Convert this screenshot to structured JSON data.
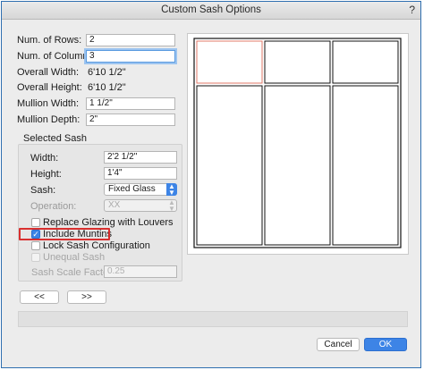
{
  "window": {
    "title": "Custom Sash Options",
    "help_glyph": "?"
  },
  "form": {
    "rows_label": "Num. of Rows:",
    "rows_value": "2",
    "columns_label": "Num. of Columns:",
    "columns_value": "3",
    "overall_width_label": "Overall Width:",
    "overall_width_value": "6'10 1/2\"",
    "overall_height_label": "Overall Height:",
    "overall_height_value": "6'10 1/2\"",
    "mullion_width_label": "Mullion Width:",
    "mullion_width_value": "1 1/2\"",
    "mullion_depth_label": "Mullion Depth:",
    "mullion_depth_value": "2\""
  },
  "selected_sash": {
    "group_label": "Selected Sash",
    "width_label": "Width:",
    "width_value": "2'2 1/2\"",
    "height_label": "Height:",
    "height_value": "1'4\"",
    "sash_label": "Sash:",
    "sash_value": "Fixed Glass",
    "operation_label": "Operation:",
    "operation_value": "XX",
    "replace_glazing_label": "Replace Glazing with Louvers",
    "include_muntins_label": "Include Muntins",
    "lock_sash_label": "Lock Sash Configuration",
    "unequal_sash_label": "Unequal Sash",
    "scale_factor_label": "Sash Scale Factor:",
    "scale_factor_value": "0.25"
  },
  "checkboxes": {
    "replace_glazing": false,
    "include_muntins": true,
    "lock_sash": false,
    "unequal_sash": false
  },
  "nav": {
    "prev_label": "<<",
    "next_label": ">>"
  },
  "actions": {
    "cancel_label": "Cancel",
    "ok_label": "OK"
  },
  "preview": {
    "rows": 2,
    "columns": 3,
    "selected_cell": {
      "row": 1,
      "column": 1
    },
    "selection_color": "#e0786a"
  },
  "colors": {
    "accent": "#3d84e6",
    "highlight_box": "#d9302f"
  }
}
